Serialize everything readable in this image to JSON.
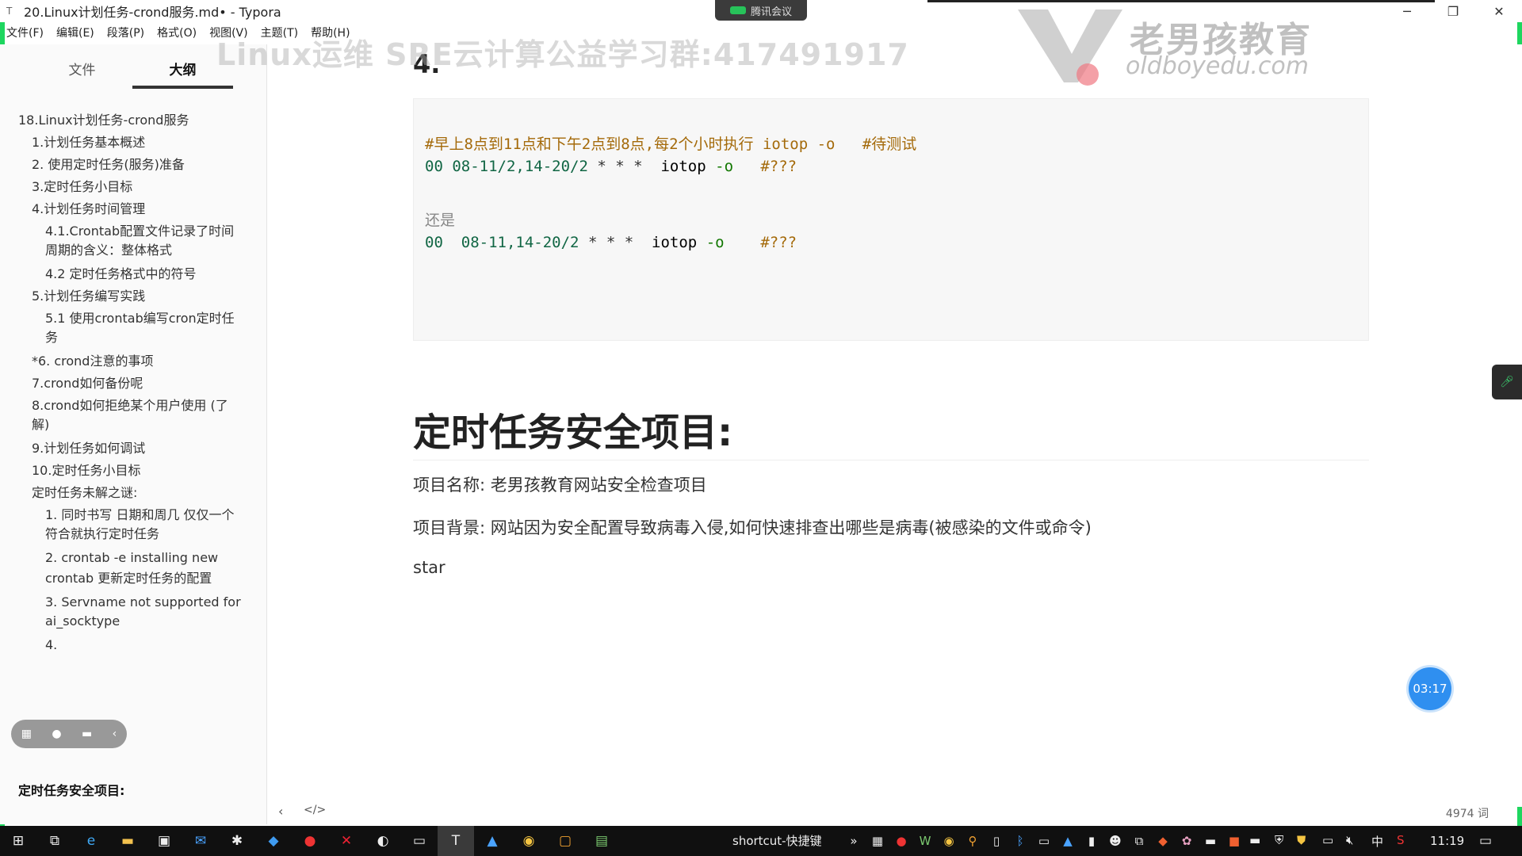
{
  "window": {
    "title": "20.Linux计划任务-crond服务.md• - Typora",
    "meeting_label": "腾讯会议"
  },
  "menubar": [
    "文件(F)",
    "编辑(E)",
    "段落(P)",
    "格式(O)",
    "视图(V)",
    "主题(T)",
    "帮助(H)"
  ],
  "sidebar": {
    "tabs": [
      {
        "label": "文件",
        "active": false
      },
      {
        "label": "大纲",
        "active": true
      }
    ],
    "outline": [
      {
        "text": "18.Linux计划任务-crond服务",
        "level": 0
      },
      {
        "text": "1.计划任务基本概述",
        "level": 1
      },
      {
        "text": "2. 使用定时任务(服务)准备",
        "level": 1
      },
      {
        "text": "3.定时任务小目标",
        "level": 1
      },
      {
        "text": "4.计划任务时间管理",
        "level": 1
      },
      {
        "text": "4.1.Crontab配置文件记录了时间",
        "level": 2
      },
      {
        "text": "周期的含义：整体格式",
        "level": 2
      },
      {
        "text": "4.2 定时任务格式中的符号",
        "level": 2
      },
      {
        "text": "5.计划任务编写实践",
        "level": 1
      },
      {
        "text": "5.1 使用crontab编写cron定时任",
        "level": 2
      },
      {
        "text": "务",
        "level": 2
      },
      {
        "text": "*6. crond注意的事项",
        "level": 1
      },
      {
        "text": "7.crond如何备份呢",
        "level": 1
      },
      {
        "text": "8.crond如何拒绝某个用户使用 (了",
        "level": 1
      },
      {
        "text": "解)",
        "level": 1
      },
      {
        "text": "9.计划任务如何调试",
        "level": 1
      },
      {
        "text": "10.定时任务小目标",
        "level": 1
      },
      {
        "text": "定时任务未解之谜:",
        "level": 1
      },
      {
        "text": "1. 同时书写 日期和周几 仅仅一个",
        "level": 2
      },
      {
        "text": "符合就执行定时任务",
        "level": 2
      },
      {
        "text": "2. crontab -e installing new",
        "level": 2
      },
      {
        "text": "crontab 更新定时任务的配置",
        "level": 2
      },
      {
        "text": "3. Servname not supported for",
        "level": 2
      },
      {
        "text": "ai_socktype",
        "level": 2
      },
      {
        "text": "4.",
        "level": 2
      }
    ],
    "bottom_item": "定时任务安全项目:"
  },
  "watermark": {
    "text": "Linux运维 SRE云计算公益学习群:417491917",
    "logo_cn": "老男孩教育",
    "logo_en": "oldboyedu.com"
  },
  "editor": {
    "section_number": "4.",
    "code": {
      "line1_comment": "#早上8点到11点和下午2点到8点,每2个小时执行 iotop -o   #待测试",
      "line2_min": "00",
      "line2_hour": "08-11/2,14-20/2",
      "line2_rest": "* * *",
      "line2_cmd": "iotop",
      "line2_opt": "-o",
      "line2_comment": "#???",
      "line3": "还是",
      "line4_min": "00",
      "line4_hour": "08-11,14-20/2",
      "line4_rest": "* * *",
      "line4_cmd": "iotop",
      "line4_opt": "-o",
      "line4_comment": "#???"
    },
    "heading": "定时任务安全项目:",
    "project_name": "项目名称:  老男孩教育网站安全检查项目",
    "project_background": "项目背景:   网站因为安全配置导致病毒入侵,如何快速排查出哪些是病毒(被感染的文件或命令)",
    "typing_line": "star",
    "timer": "03:17"
  },
  "footer": {
    "word_count": "4974 词"
  },
  "taskbar": {
    "shortcut_label": "shortcut-快捷键",
    "time": "11:19",
    "ime_label": "中"
  }
}
